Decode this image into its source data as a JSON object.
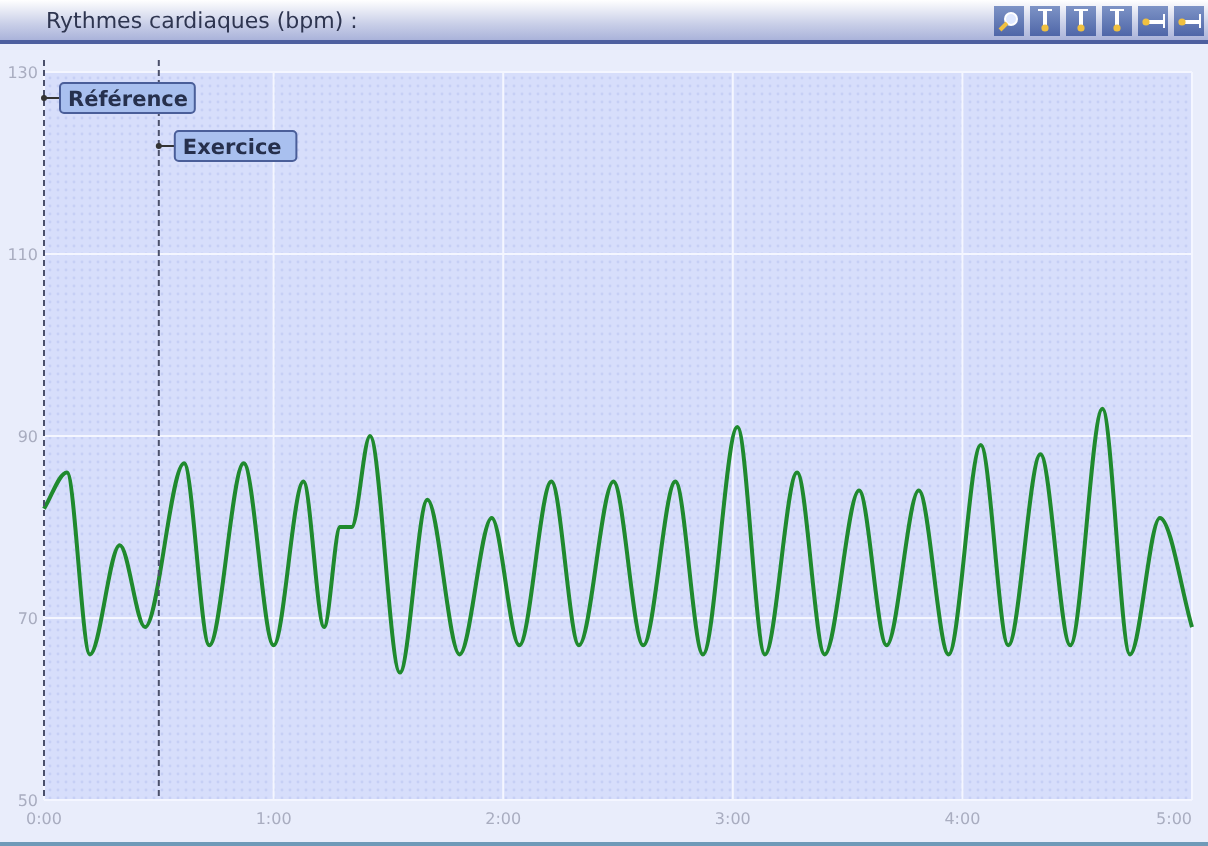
{
  "title": "Rythmes cardiaques (bpm) :",
  "chart_data": {
    "type": "line",
    "xlim": [
      0,
      5
    ],
    "ylim": [
      50,
      130
    ],
    "xticks": [
      {
        "value": 0,
        "label": "0:00"
      },
      {
        "value": 1,
        "label": "1:00"
      },
      {
        "value": 2,
        "label": "2:00"
      },
      {
        "value": 3,
        "label": "3:00"
      },
      {
        "value": 4,
        "label": "4:00"
      },
      {
        "value": 5,
        "label": "5:00"
      }
    ],
    "yticks": [
      50,
      70,
      90,
      110,
      130
    ],
    "x": [
      0,
      0.1,
      0.2,
      0.33,
      0.44,
      0.61,
      0.72,
      0.87,
      1.0,
      1.13,
      1.22,
      1.29,
      1.34,
      1.42,
      1.55,
      1.67,
      1.81,
      1.95,
      2.07,
      2.21,
      2.33,
      2.48,
      2.61,
      2.75,
      2.87,
      3.02,
      3.14,
      3.28,
      3.4,
      3.55,
      3.67,
      3.81,
      3.94,
      4.08,
      4.2,
      4.34,
      4.47,
      4.61,
      4.73,
      4.86,
      5.0
    ],
    "series": [
      {
        "color": "#1f8a2e",
        "values": [
          82,
          86,
          66,
          78,
          69,
          87,
          67,
          87,
          67,
          85,
          69,
          80,
          80,
          90,
          64,
          83,
          66,
          81,
          67,
          85,
          67,
          85,
          67,
          85,
          66,
          91,
          66,
          86,
          66,
          84,
          67,
          84,
          66,
          89,
          67,
          88,
          67,
          93,
          66,
          81,
          69
        ]
      }
    ],
    "grid": true,
    "ref_lines": [
      {
        "axis": "x",
        "value": 0,
        "label": "Référence"
      },
      {
        "axis": "x",
        "value": 0.5,
        "label": "Exercice"
      }
    ]
  }
}
